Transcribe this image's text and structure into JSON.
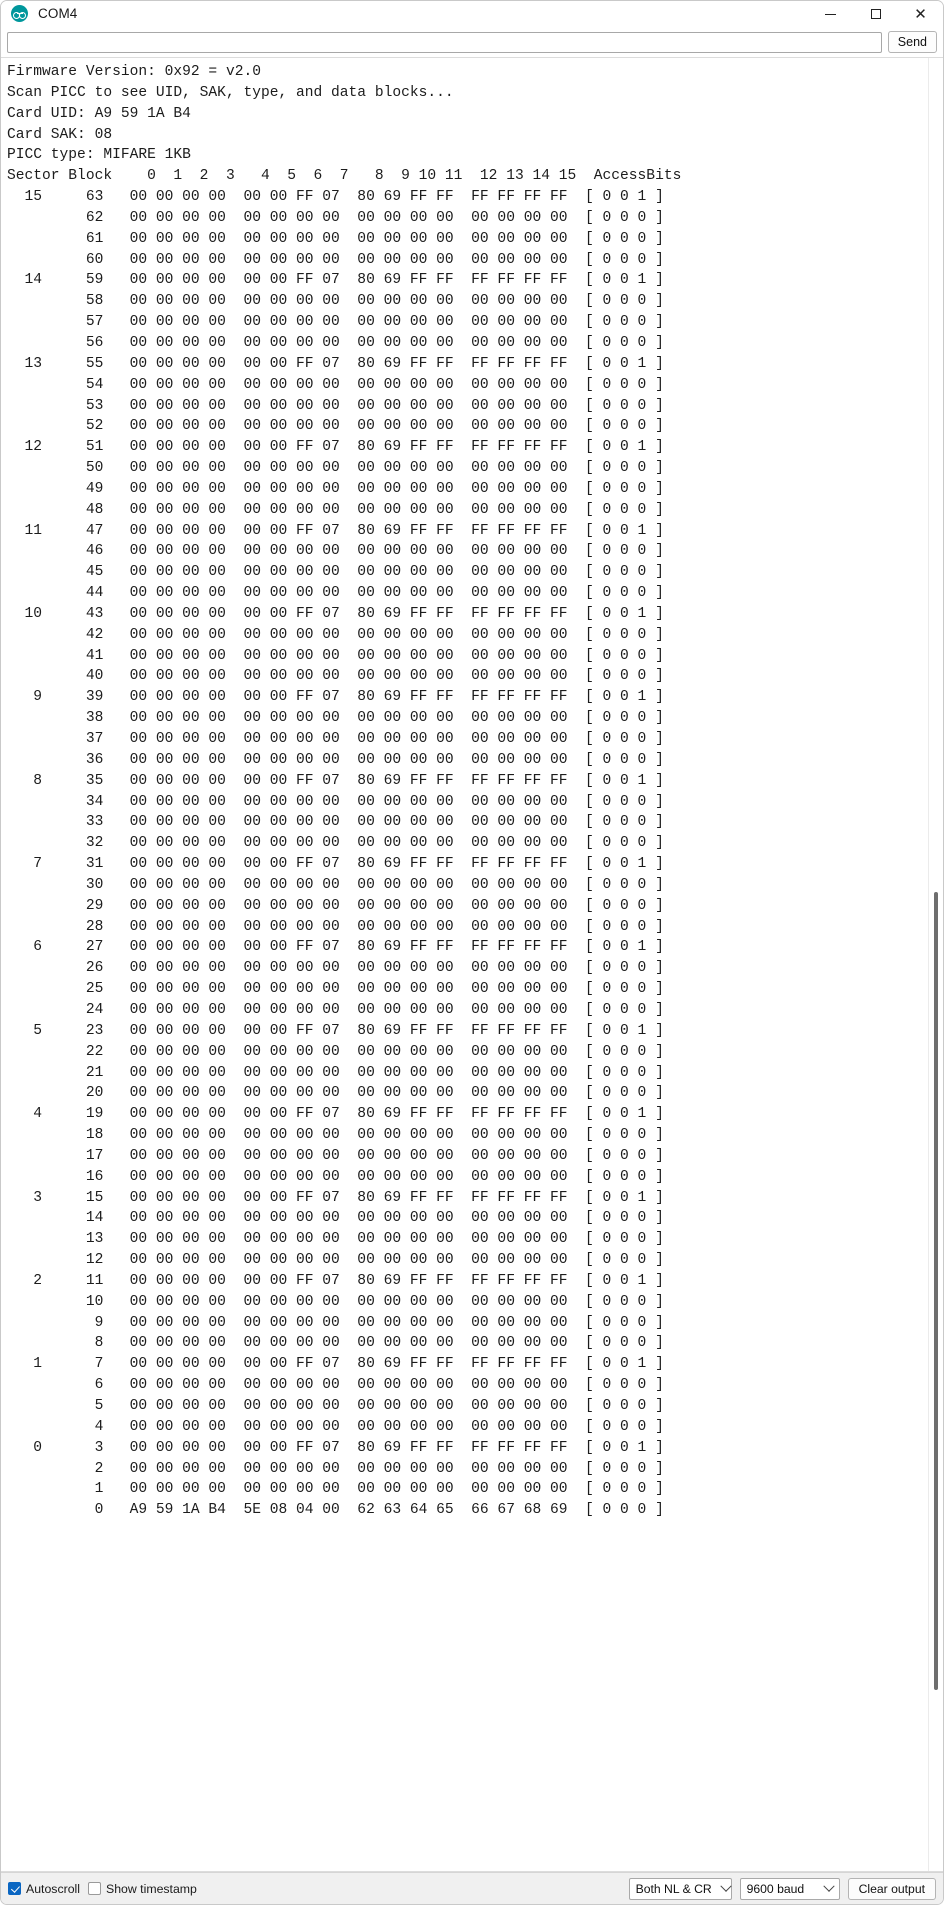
{
  "window": {
    "title": "COM4",
    "logo_icon": "arduino-logo-icon",
    "minimize_icon": "minimize-icon",
    "maximize_icon": "maximize-icon",
    "close_icon": "close-icon"
  },
  "send_bar": {
    "input_value": "",
    "input_placeholder": "",
    "send_label": "Send"
  },
  "status_bar": {
    "autoscroll_label": "Autoscroll",
    "autoscroll_checked": true,
    "timestamp_label": "Show timestamp",
    "timestamp_checked": false,
    "line_ending_value": "Both NL & CR",
    "baud_value": "9600 baud",
    "clear_label": "Clear output",
    "accent_color": "#0a66c2"
  },
  "console": {
    "header_lines": [
      "Firmware Version: 0x92 = v2.0",
      "Scan PICC to see UID, SAK, type, and data blocks...",
      "Card UID: A9 59 1A B4",
      "Card SAK: 08",
      "PICC type: MIFARE 1KB"
    ],
    "table_header": "Sector Block   0  1  2  3   4  5  6  7   8  9 10 11  12 13 14 15  AccessBits",
    "column_labels": [
      "0",
      "1",
      "2",
      "3",
      "4",
      "5",
      "6",
      "7",
      "8",
      "9",
      "10",
      "11",
      "12",
      "13",
      "14",
      "15"
    ],
    "col_sector": "Sector",
    "col_block": "Block",
    "col_access": "AccessBits",
    "trailer_bytes": [
      "00",
      "00",
      "00",
      "00",
      "00",
      "00",
      "FF",
      "07",
      "80",
      "69",
      "FF",
      "FF",
      "FF",
      "FF",
      "FF",
      "FF"
    ],
    "zero_bytes": [
      "00",
      "00",
      "00",
      "00",
      "00",
      "00",
      "00",
      "00",
      "00",
      "00",
      "00",
      "00",
      "00",
      "00",
      "00",
      "00"
    ],
    "block0_bytes": [
      "A9",
      "59",
      "1A",
      "B4",
      "5E",
      "08",
      "04",
      "00",
      "62",
      "63",
      "64",
      "65",
      "66",
      "67",
      "68",
      "69"
    ],
    "trailer_access": [
      "0",
      "0",
      "1"
    ],
    "normal_access": [
      "0",
      "0",
      "0"
    ],
    "sectors": [
      {
        "sector": "15",
        "blocks": [
          {
            "block": "63",
            "kind": "trailer"
          },
          {
            "block": "62",
            "kind": "zero"
          },
          {
            "block": "61",
            "kind": "zero"
          },
          {
            "block": "60",
            "kind": "zero"
          }
        ]
      },
      {
        "sector": "14",
        "blocks": [
          {
            "block": "59",
            "kind": "trailer"
          },
          {
            "block": "58",
            "kind": "zero"
          },
          {
            "block": "57",
            "kind": "zero"
          },
          {
            "block": "56",
            "kind": "zero"
          }
        ]
      },
      {
        "sector": "13",
        "blocks": [
          {
            "block": "55",
            "kind": "trailer"
          },
          {
            "block": "54",
            "kind": "zero"
          },
          {
            "block": "53",
            "kind": "zero"
          },
          {
            "block": "52",
            "kind": "zero"
          }
        ]
      },
      {
        "sector": "12",
        "blocks": [
          {
            "block": "51",
            "kind": "trailer"
          },
          {
            "block": "50",
            "kind": "zero"
          },
          {
            "block": "49",
            "kind": "zero"
          },
          {
            "block": "48",
            "kind": "zero"
          }
        ]
      },
      {
        "sector": "11",
        "blocks": [
          {
            "block": "47",
            "kind": "trailer"
          },
          {
            "block": "46",
            "kind": "zero"
          },
          {
            "block": "45",
            "kind": "zero"
          },
          {
            "block": "44",
            "kind": "zero"
          }
        ]
      },
      {
        "sector": "10",
        "blocks": [
          {
            "block": "43",
            "kind": "trailer"
          },
          {
            "block": "42",
            "kind": "zero"
          },
          {
            "block": "41",
            "kind": "zero"
          },
          {
            "block": "40",
            "kind": "zero"
          }
        ]
      },
      {
        "sector": "9",
        "blocks": [
          {
            "block": "39",
            "kind": "trailer"
          },
          {
            "block": "38",
            "kind": "zero"
          },
          {
            "block": "37",
            "kind": "zero"
          },
          {
            "block": "36",
            "kind": "zero"
          }
        ]
      },
      {
        "sector": "8",
        "blocks": [
          {
            "block": "35",
            "kind": "trailer"
          },
          {
            "block": "34",
            "kind": "zero"
          },
          {
            "block": "33",
            "kind": "zero"
          },
          {
            "block": "32",
            "kind": "zero"
          }
        ]
      },
      {
        "sector": "7",
        "blocks": [
          {
            "block": "31",
            "kind": "trailer"
          },
          {
            "block": "30",
            "kind": "zero"
          },
          {
            "block": "29",
            "kind": "zero"
          },
          {
            "block": "28",
            "kind": "zero"
          }
        ]
      },
      {
        "sector": "6",
        "blocks": [
          {
            "block": "27",
            "kind": "trailer"
          },
          {
            "block": "26",
            "kind": "zero"
          },
          {
            "block": "25",
            "kind": "zero"
          },
          {
            "block": "24",
            "kind": "zero"
          }
        ]
      },
      {
        "sector": "5",
        "blocks": [
          {
            "block": "23",
            "kind": "trailer"
          },
          {
            "block": "22",
            "kind": "zero"
          },
          {
            "block": "21",
            "kind": "zero"
          },
          {
            "block": "20",
            "kind": "zero"
          }
        ]
      },
      {
        "sector": "4",
        "blocks": [
          {
            "block": "19",
            "kind": "trailer"
          },
          {
            "block": "18",
            "kind": "zero"
          },
          {
            "block": "17",
            "kind": "zero"
          },
          {
            "block": "16",
            "kind": "zero"
          }
        ]
      },
      {
        "sector": "3",
        "blocks": [
          {
            "block": "15",
            "kind": "trailer"
          },
          {
            "block": "14",
            "kind": "zero"
          },
          {
            "block": "13",
            "kind": "zero"
          },
          {
            "block": "12",
            "kind": "zero"
          }
        ]
      },
      {
        "sector": "2",
        "blocks": [
          {
            "block": "11",
            "kind": "trailer"
          },
          {
            "block": "10",
            "kind": "zero"
          },
          {
            "block": "9",
            "kind": "zero"
          },
          {
            "block": "8",
            "kind": "zero"
          }
        ]
      },
      {
        "sector": "1",
        "blocks": [
          {
            "block": "7",
            "kind": "trailer"
          },
          {
            "block": "6",
            "kind": "zero"
          },
          {
            "block": "5",
            "kind": "zero"
          },
          {
            "block": "4",
            "kind": "zero"
          }
        ]
      },
      {
        "sector": "0",
        "blocks": [
          {
            "block": "3",
            "kind": "trailer"
          },
          {
            "block": "2",
            "kind": "zero"
          },
          {
            "block": "1",
            "kind": "zero"
          },
          {
            "block": "0",
            "kind": "block0"
          }
        ]
      }
    ]
  },
  "scrollbar": {
    "thumb_top_pct": 46,
    "thumb_height_pct": 44
  }
}
